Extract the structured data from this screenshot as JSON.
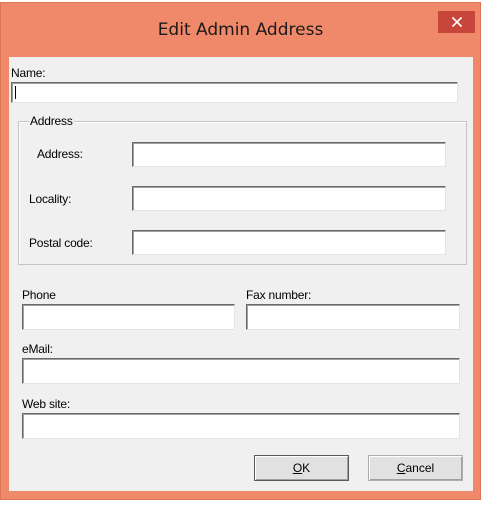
{
  "window": {
    "title": "Edit Admin Address",
    "close_glyph": "✕",
    "accent_color": "#f0896a",
    "close_color": "#c7463b"
  },
  "form": {
    "name": {
      "label": "Name:",
      "value": ""
    },
    "address_group": {
      "legend": "Address",
      "address": {
        "label": "Address:",
        "value": ""
      },
      "locality": {
        "label": "Locality:",
        "value": ""
      },
      "postal_code": {
        "label": "Postal code:",
        "value": ""
      }
    },
    "phone": {
      "label": "Phone",
      "value": ""
    },
    "fax": {
      "label": "Fax number:",
      "value": ""
    },
    "email": {
      "label": "eMail:",
      "value": ""
    },
    "website": {
      "label": "Web site:",
      "value": ""
    }
  },
  "buttons": {
    "ok": {
      "mnemonic": "O",
      "rest": "K"
    },
    "cancel": {
      "mnemonic": "C",
      "rest": "ancel"
    }
  },
  "icons": {
    "close": "close-icon"
  }
}
